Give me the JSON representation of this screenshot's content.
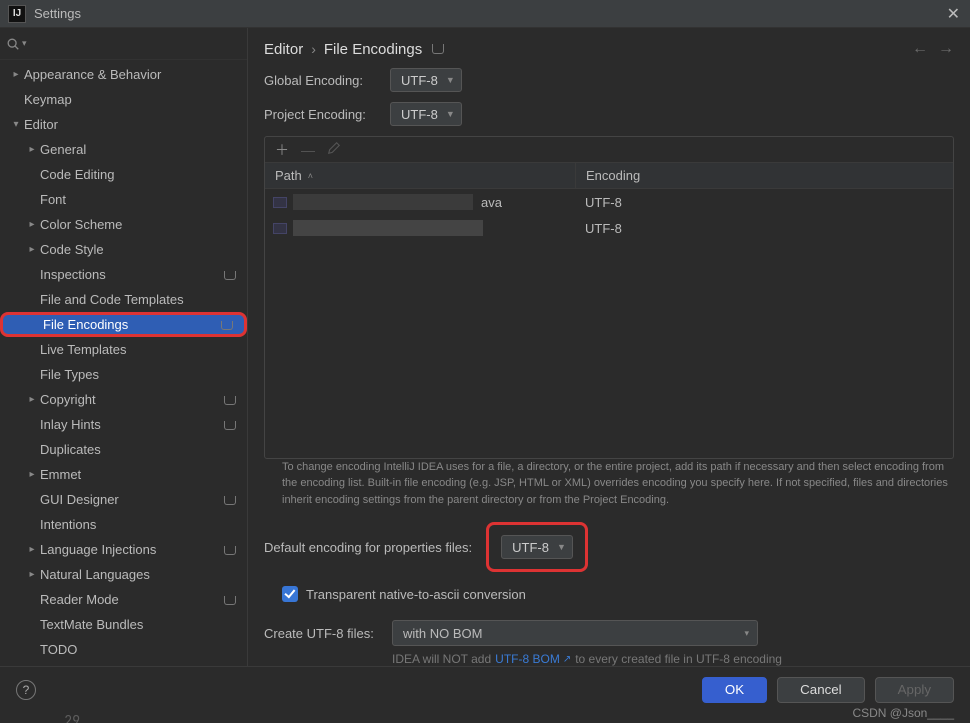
{
  "window": {
    "title": "Settings"
  },
  "search": {
    "placeholder": ""
  },
  "sidebar": {
    "items": [
      {
        "label": "Appearance & Behavior",
        "depth": 0,
        "chevron": "right",
        "restart": false
      },
      {
        "label": "Keymap",
        "depth": 0,
        "chevron": "none",
        "restart": false
      },
      {
        "label": "Editor",
        "depth": 0,
        "chevron": "down",
        "restart": false
      },
      {
        "label": "General",
        "depth": 1,
        "chevron": "right",
        "restart": false
      },
      {
        "label": "Code Editing",
        "depth": 1,
        "chevron": "none",
        "restart": false
      },
      {
        "label": "Font",
        "depth": 1,
        "chevron": "none",
        "restart": false
      },
      {
        "label": "Color Scheme",
        "depth": 1,
        "chevron": "right",
        "restart": false
      },
      {
        "label": "Code Style",
        "depth": 1,
        "chevron": "right",
        "restart": false
      },
      {
        "label": "Inspections",
        "depth": 1,
        "chevron": "none",
        "restart": true
      },
      {
        "label": "File and Code Templates",
        "depth": 1,
        "chevron": "none",
        "restart": false
      },
      {
        "label": "File Encodings",
        "depth": 1,
        "chevron": "none",
        "restart": true,
        "selected": true,
        "highlighted": true
      },
      {
        "label": "Live Templates",
        "depth": 1,
        "chevron": "none",
        "restart": false
      },
      {
        "label": "File Types",
        "depth": 1,
        "chevron": "none",
        "restart": false
      },
      {
        "label": "Copyright",
        "depth": 1,
        "chevron": "right",
        "restart": true
      },
      {
        "label": "Inlay Hints",
        "depth": 1,
        "chevron": "none",
        "restart": true
      },
      {
        "label": "Duplicates",
        "depth": 1,
        "chevron": "none",
        "restart": false
      },
      {
        "label": "Emmet",
        "depth": 1,
        "chevron": "right",
        "restart": false
      },
      {
        "label": "GUI Designer",
        "depth": 1,
        "chevron": "none",
        "restart": true
      },
      {
        "label": "Intentions",
        "depth": 1,
        "chevron": "none",
        "restart": false
      },
      {
        "label": "Language Injections",
        "depth": 1,
        "chevron": "right",
        "restart": true
      },
      {
        "label": "Natural Languages",
        "depth": 1,
        "chevron": "right",
        "restart": false
      },
      {
        "label": "Reader Mode",
        "depth": 1,
        "chevron": "none",
        "restart": true
      },
      {
        "label": "TextMate Bundles",
        "depth": 1,
        "chevron": "none",
        "restart": false
      },
      {
        "label": "TODO",
        "depth": 1,
        "chevron": "none",
        "restart": false
      }
    ]
  },
  "breadcrumb": {
    "parent": "Editor",
    "current": "File Encodings"
  },
  "globalEncoding": {
    "label": "Global Encoding:",
    "value": "UTF-8"
  },
  "projectEncoding": {
    "label": "Project Encoding:",
    "value": "UTF-8"
  },
  "table": {
    "col_path": "Path",
    "col_enc": "Encoding",
    "rows": [
      {
        "path_tail": "ava",
        "enc": "UTF-8"
      },
      {
        "path_tail": "",
        "enc": "UTF-8"
      }
    ]
  },
  "hint": "To change encoding IntelliJ IDEA uses for a file, a directory, or the entire project, add its path if necessary and then select encoding from the encoding list. Built-in file encoding (e.g. JSP, HTML or XML) overrides encoding you specify here. If not specified, files and directories inherit encoding settings from the parent directory or from the Project Encoding.",
  "propsEncoding": {
    "label": "Default encoding for properties files:",
    "value": "UTF-8"
  },
  "transparentAscii": {
    "label": "Transparent native-to-ascii conversion",
    "checked": true
  },
  "bom": {
    "label": "Create UTF-8 files:",
    "value": "with NO BOM",
    "hint_prefix": "IDEA will NOT add",
    "hint_link": "UTF-8 BOM",
    "hint_suffix": "to every created file in UTF-8 encoding"
  },
  "buttons": {
    "ok": "OK",
    "cancel": "Cancel",
    "apply": "Apply"
  },
  "watermark": "CSDN @Json____"
}
